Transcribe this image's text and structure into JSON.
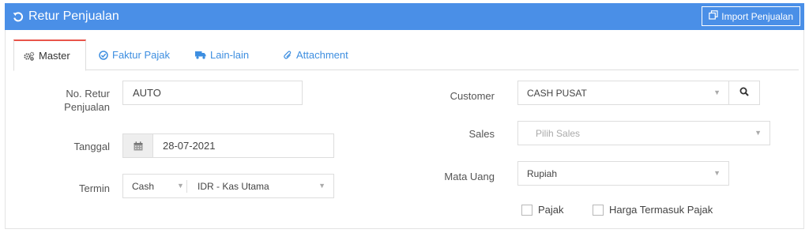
{
  "header": {
    "title": "Retur Penjualan",
    "title_icon": "undo-icon",
    "import_label": "Import Penjualan",
    "import_icon": "copy-icon",
    "color": "#4a8fe7"
  },
  "tabs": [
    {
      "label": "Master",
      "icon": "cogs-icon",
      "active": true
    },
    {
      "label": "Faktur Pajak",
      "icon": "check-circle-icon",
      "active": false
    },
    {
      "label": "Lain-lain",
      "icon": "truck-icon",
      "active": false
    },
    {
      "label": "Attachment",
      "icon": "paperclip-icon",
      "active": false
    }
  ],
  "form": {
    "no_retur": {
      "label_line1": "No. Retur",
      "label_line2": "Penjualan",
      "value": "AUTO"
    },
    "tanggal": {
      "label": "Tanggal",
      "value": "28-07-2021",
      "icon": "calendar-icon"
    },
    "termin": {
      "label": "Termin",
      "value": "Cash",
      "account": "IDR - Kas Utama"
    },
    "customer": {
      "label": "Customer",
      "value": "CASH PUSAT",
      "search_icon": "search-icon"
    },
    "sales": {
      "label": "Sales",
      "placeholder": "Pilih Sales"
    },
    "mata_uang": {
      "label": "Mata Uang",
      "value": "Rupiah"
    },
    "pajak": {
      "label": "Pajak",
      "checked": false
    },
    "harga_termasuk_pajak": {
      "label": "Harga Termasuk Pajak",
      "checked": false
    }
  },
  "colors": {
    "accent": "#4a8fe7",
    "active_tab_border": "#e8544a",
    "link": "#3d8ee0"
  }
}
